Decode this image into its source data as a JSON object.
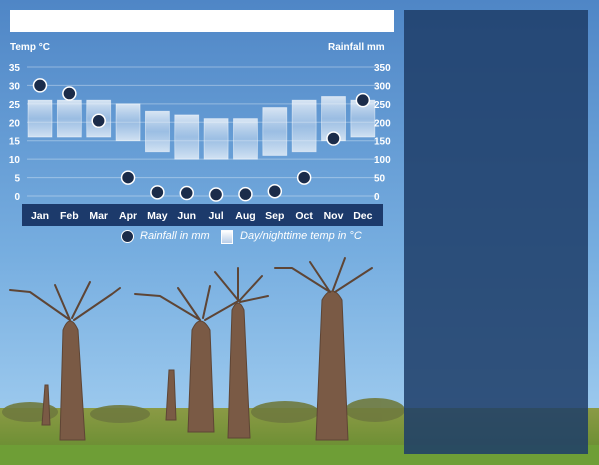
{
  "title": "",
  "left_axis_title": "Temp °C",
  "right_axis_title": "Rainfall mm",
  "legend": {
    "rainfall": "Rainfall in mm",
    "temp": "Day/nighttime temp in °C"
  },
  "colors": {
    "sky_top": "#4f86c6",
    "sky_bottom": "#8fc0ea",
    "month_band": "#1c3a6b",
    "rain_dot": "#1b2c4a",
    "side_panel": "#1e3e69"
  },
  "chart_data": {
    "type": "bar",
    "categories": [
      "Jan",
      "Feb",
      "Mar",
      "Apr",
      "May",
      "Jun",
      "Jul",
      "Aug",
      "Sep",
      "Oct",
      "Nov",
      "Dec"
    ],
    "series": [
      {
        "name": "Day/nighttime temp in °C",
        "type": "range-bar",
        "low": [
          16,
          16,
          16,
          15,
          12,
          10,
          10,
          10,
          11,
          12,
          15,
          16
        ],
        "high": [
          26,
          26,
          26,
          25,
          23,
          22,
          21,
          21,
          24,
          26,
          27,
          26
        ]
      },
      {
        "name": "Rainfall in mm",
        "type": "scatter",
        "values": [
          300,
          278,
          204,
          50,
          10,
          8,
          4,
          5,
          13,
          50,
          156,
          260
        ]
      }
    ],
    "left_axis": {
      "label": "Temp °C",
      "ticks": [
        0,
        5,
        10,
        15,
        20,
        25,
        30,
        35
      ],
      "range": [
        0,
        35
      ]
    },
    "right_axis": {
      "label": "Rainfall mm",
      "ticks": [
        0,
        50,
        100,
        150,
        200,
        250,
        300,
        350
      ],
      "range": [
        0,
        350
      ]
    },
    "grid": true,
    "legend_position": "bottom"
  }
}
